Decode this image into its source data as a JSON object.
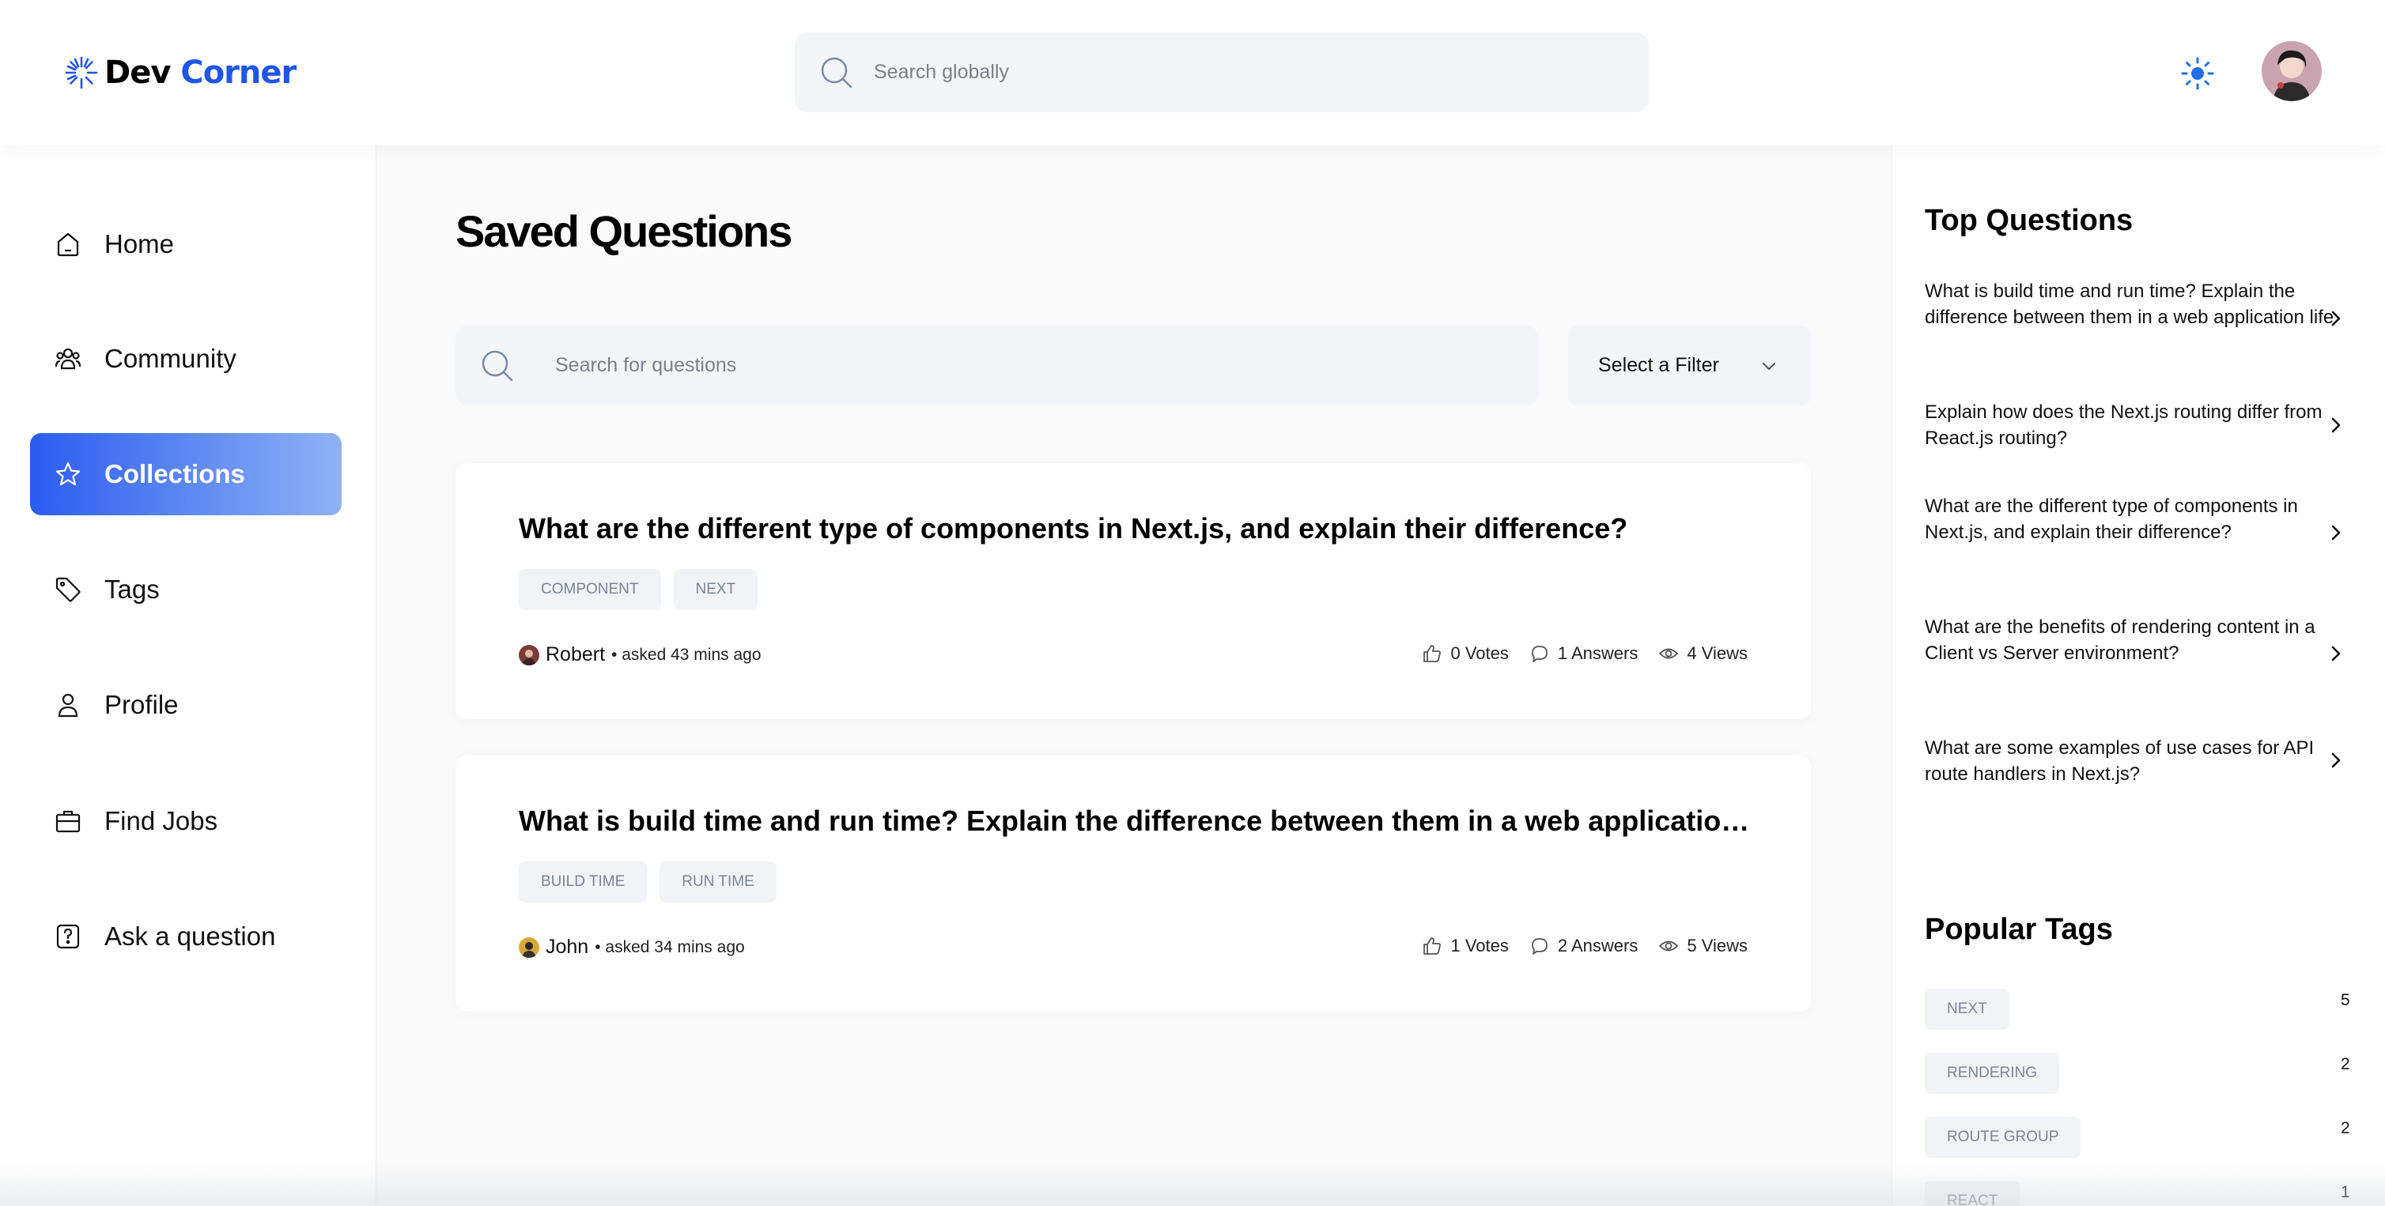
{
  "brand": {
    "first": "Dev",
    "second": "Corner"
  },
  "header": {
    "search_placeholder": "Search globally"
  },
  "sidebar": {
    "items": [
      {
        "label": "Home",
        "icon": "home-icon",
        "active": false
      },
      {
        "label": "Community",
        "icon": "users-icon",
        "active": false
      },
      {
        "label": "Collections",
        "icon": "star-icon",
        "active": true
      },
      {
        "label": "Tags",
        "icon": "tag-icon",
        "active": false
      },
      {
        "label": "Profile",
        "icon": "user-icon",
        "active": false
      },
      {
        "label": "Find Jobs",
        "icon": "briefcase-icon",
        "active": false
      },
      {
        "label": "Ask a question",
        "icon": "question-icon",
        "active": false
      }
    ]
  },
  "main": {
    "title": "Saved Questions",
    "search_placeholder": "Search for questions",
    "filter_label": "Select a Filter",
    "questions": [
      {
        "title": "What are the different type of components in Next.js, and explain their difference?",
        "tags": [
          "COMPONENT",
          "NEXT"
        ],
        "author": "Robert",
        "asked": "• asked 43 mins ago",
        "votes": "0 Votes",
        "answers": "1 Answers",
        "views": "4 Views"
      },
      {
        "title": "What is build time and run time? Explain the difference between them in a web application life",
        "tags": [
          "BUILD TIME",
          "RUN TIME"
        ],
        "author": "John",
        "asked": "• asked 34 mins ago",
        "votes": "1 Votes",
        "answers": "2 Answers",
        "views": "5 Views"
      }
    ]
  },
  "right": {
    "top_title": "Top Questions",
    "top_questions": [
      "What is build time and run time? Explain the difference between them in a web application life",
      "Explain how does the Next.js routing differ from React.js routing?",
      "What are the different type of components in Next.js, and explain their difference?",
      "What are the benefits of rendering content in a Client vs Server environment?",
      "What are some examples of use cases for API route handlers in Next.js?"
    ],
    "tags_title": "Popular Tags",
    "popular_tags": [
      {
        "name": "NEXT",
        "count": "5"
      },
      {
        "name": "RENDERING",
        "count": "2"
      },
      {
        "name": "ROUTE GROUP",
        "count": "2"
      },
      {
        "name": "REACT",
        "count": "1"
      }
    ]
  },
  "colors": {
    "brand": "#1f56e8",
    "active_gradient_start": "#2b5cf0",
    "active_gradient_end": "#8fb3f4",
    "theme_icon": "#1f6feb"
  }
}
